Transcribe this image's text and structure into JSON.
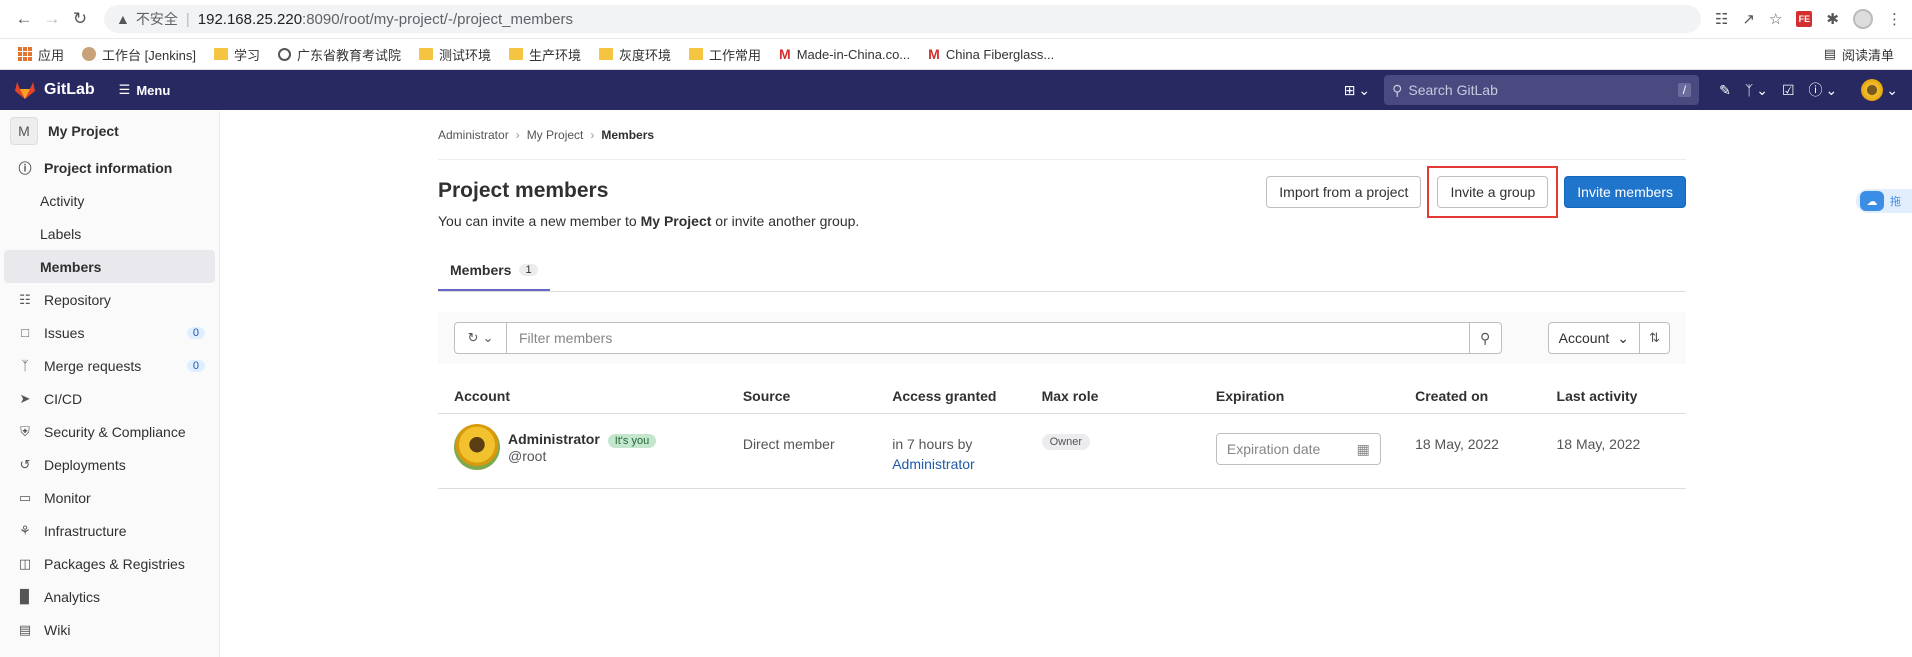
{
  "browser": {
    "insecure_label": "不安全",
    "url_host": "192.168.25.220",
    "url_rest": ":8090/root/my-project/-/project_members",
    "ext_label": "FE"
  },
  "bookmarks": [
    {
      "label": "应用",
      "icon": "apps-icon"
    },
    {
      "label": "工作台 [Jenkins]",
      "icon": "jenkins-icon"
    },
    {
      "label": "学习",
      "icon": "folder-icon"
    },
    {
      "label": "广东省教育考试院",
      "icon": "globe-icon"
    },
    {
      "label": "测试环境",
      "icon": "folder-icon"
    },
    {
      "label": "生产环境",
      "icon": "folder-icon"
    },
    {
      "label": "灰度环境",
      "icon": "folder-icon"
    },
    {
      "label": "工作常用",
      "icon": "folder-icon"
    },
    {
      "label": "Made-in-China.co...",
      "icon": "mic-icon"
    },
    {
      "label": "China Fiberglass...",
      "icon": "mic-icon"
    }
  ],
  "reading_list": "阅读清单",
  "header": {
    "brand": "GitLab",
    "menu_label": "Menu",
    "search_placeholder": "Search GitLab",
    "search_shortcut": "/"
  },
  "sidebar": {
    "project_initial": "M",
    "project_name": "My Project",
    "items": [
      {
        "label": "Project information",
        "icon": "info-icon",
        "bold": true
      },
      {
        "label": "Activity",
        "sub": true
      },
      {
        "label": "Labels",
        "sub": true
      },
      {
        "label": "Members",
        "sub": true,
        "active": true
      },
      {
        "label": "Repository",
        "icon": "doc-icon"
      },
      {
        "label": "Issues",
        "icon": "issues-icon",
        "badge": "0"
      },
      {
        "label": "Merge requests",
        "icon": "merge-icon",
        "badge": "0"
      },
      {
        "label": "CI/CD",
        "icon": "rocket-icon"
      },
      {
        "label": "Security & Compliance",
        "icon": "shield-icon"
      },
      {
        "label": "Deployments",
        "icon": "deploy-icon"
      },
      {
        "label": "Monitor",
        "icon": "monitor-icon"
      },
      {
        "label": "Infrastructure",
        "icon": "infra-icon"
      },
      {
        "label": "Packages & Registries",
        "icon": "package-icon"
      },
      {
        "label": "Analytics",
        "icon": "chart-icon"
      },
      {
        "label": "Wiki",
        "icon": "book-icon"
      }
    ]
  },
  "breadcrumb": [
    "Administrator",
    "My Project",
    "Members"
  ],
  "page": {
    "title": "Project members",
    "desc_pre": "You can invite a new member to ",
    "desc_project": "My Project",
    "desc_post": " or invite another group.",
    "btn_import": "Import from a project",
    "btn_invite_group": "Invite a group",
    "btn_invite_members": "Invite members"
  },
  "tabs": [
    {
      "label": "Members",
      "count": "1"
    }
  ],
  "filter": {
    "placeholder": "Filter members",
    "sort_label": "Account"
  },
  "table": {
    "headers": [
      "Account",
      "Source",
      "Access granted",
      "Max role",
      "Expiration",
      "Created on",
      "Last activity"
    ],
    "rows": [
      {
        "name": "Administrator",
        "badge": "It's you",
        "handle": "@root",
        "source": "Direct member",
        "access_pre": "in 7 hours by",
        "access_by": "Administrator",
        "role": "Owner",
        "expiration_placeholder": "Expiration date",
        "created": "18 May, 2022",
        "last_activity": "18 May, 2022"
      }
    ]
  },
  "side_widget_text": "拖"
}
